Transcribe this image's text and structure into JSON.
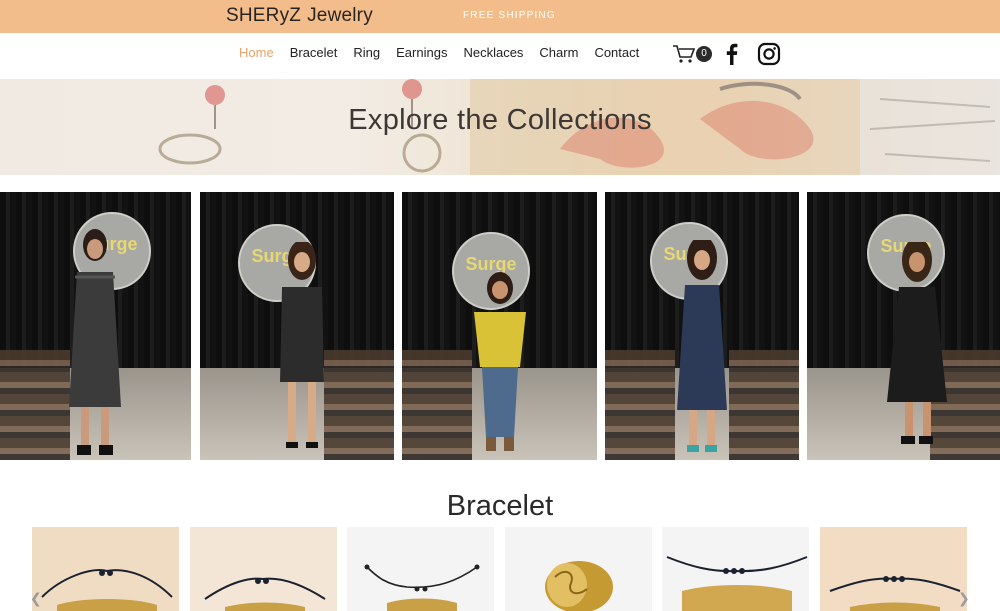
{
  "header": {
    "brand_part1": "SHERyZ",
    "brand_part2": "Jewelry",
    "free_shipping": "FREE SHIPPING"
  },
  "nav": {
    "items": [
      "Home",
      "Bracelet",
      "Ring",
      "Earnings",
      "Necklaces",
      "Charm",
      "Contact"
    ],
    "active_index": 0,
    "cart_count": "0"
  },
  "hero": {
    "title": "Explore the Collections"
  },
  "gallery": {
    "photos": [
      {
        "alt": "runway-model-1"
      },
      {
        "alt": "runway-model-2"
      },
      {
        "alt": "runway-model-3"
      },
      {
        "alt": "runway-model-4"
      },
      {
        "alt": "runway-model-5"
      }
    ],
    "sign_text": "Surge"
  },
  "bracelet_section": {
    "title": "Bracelet",
    "product_count": 6
  },
  "colors": {
    "accent": "#f2bd8b",
    "active_nav": "#e8a36a",
    "text": "#222222"
  }
}
